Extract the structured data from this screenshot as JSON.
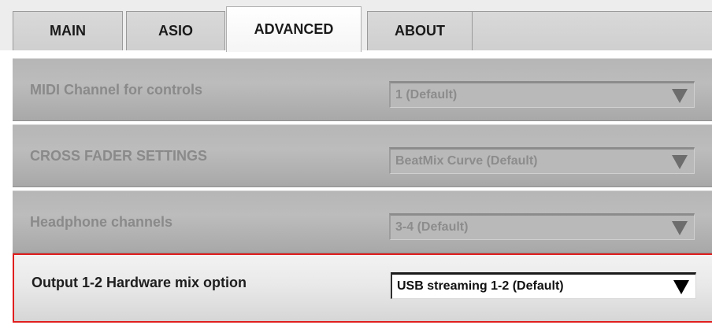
{
  "tabs": [
    {
      "label": "MAIN",
      "active": false
    },
    {
      "label": "ASIO",
      "active": false
    },
    {
      "label": "ADVANCED",
      "active": true
    },
    {
      "label": "ABOUT",
      "active": false
    }
  ],
  "settings": [
    {
      "label": "MIDI Channel for controls",
      "value": "1 (Default)",
      "enabled": false
    },
    {
      "label": "CROSS FADER SETTINGS",
      "value": "BeatMix Curve (Default)",
      "enabled": false
    },
    {
      "label": "Headphone channels",
      "value": "3-4 (Default)",
      "enabled": false
    },
    {
      "label": "Output 1-2 Hardware mix option",
      "value": "USB streaming 1-2 (Default)",
      "enabled": true
    }
  ],
  "icons": {
    "dropdown": "chevron-down-icon"
  },
  "colors": {
    "highlight_border": "#e01e1e",
    "disabled_text": "#8a8a8a",
    "enabled_text": "#1e1e1e"
  }
}
